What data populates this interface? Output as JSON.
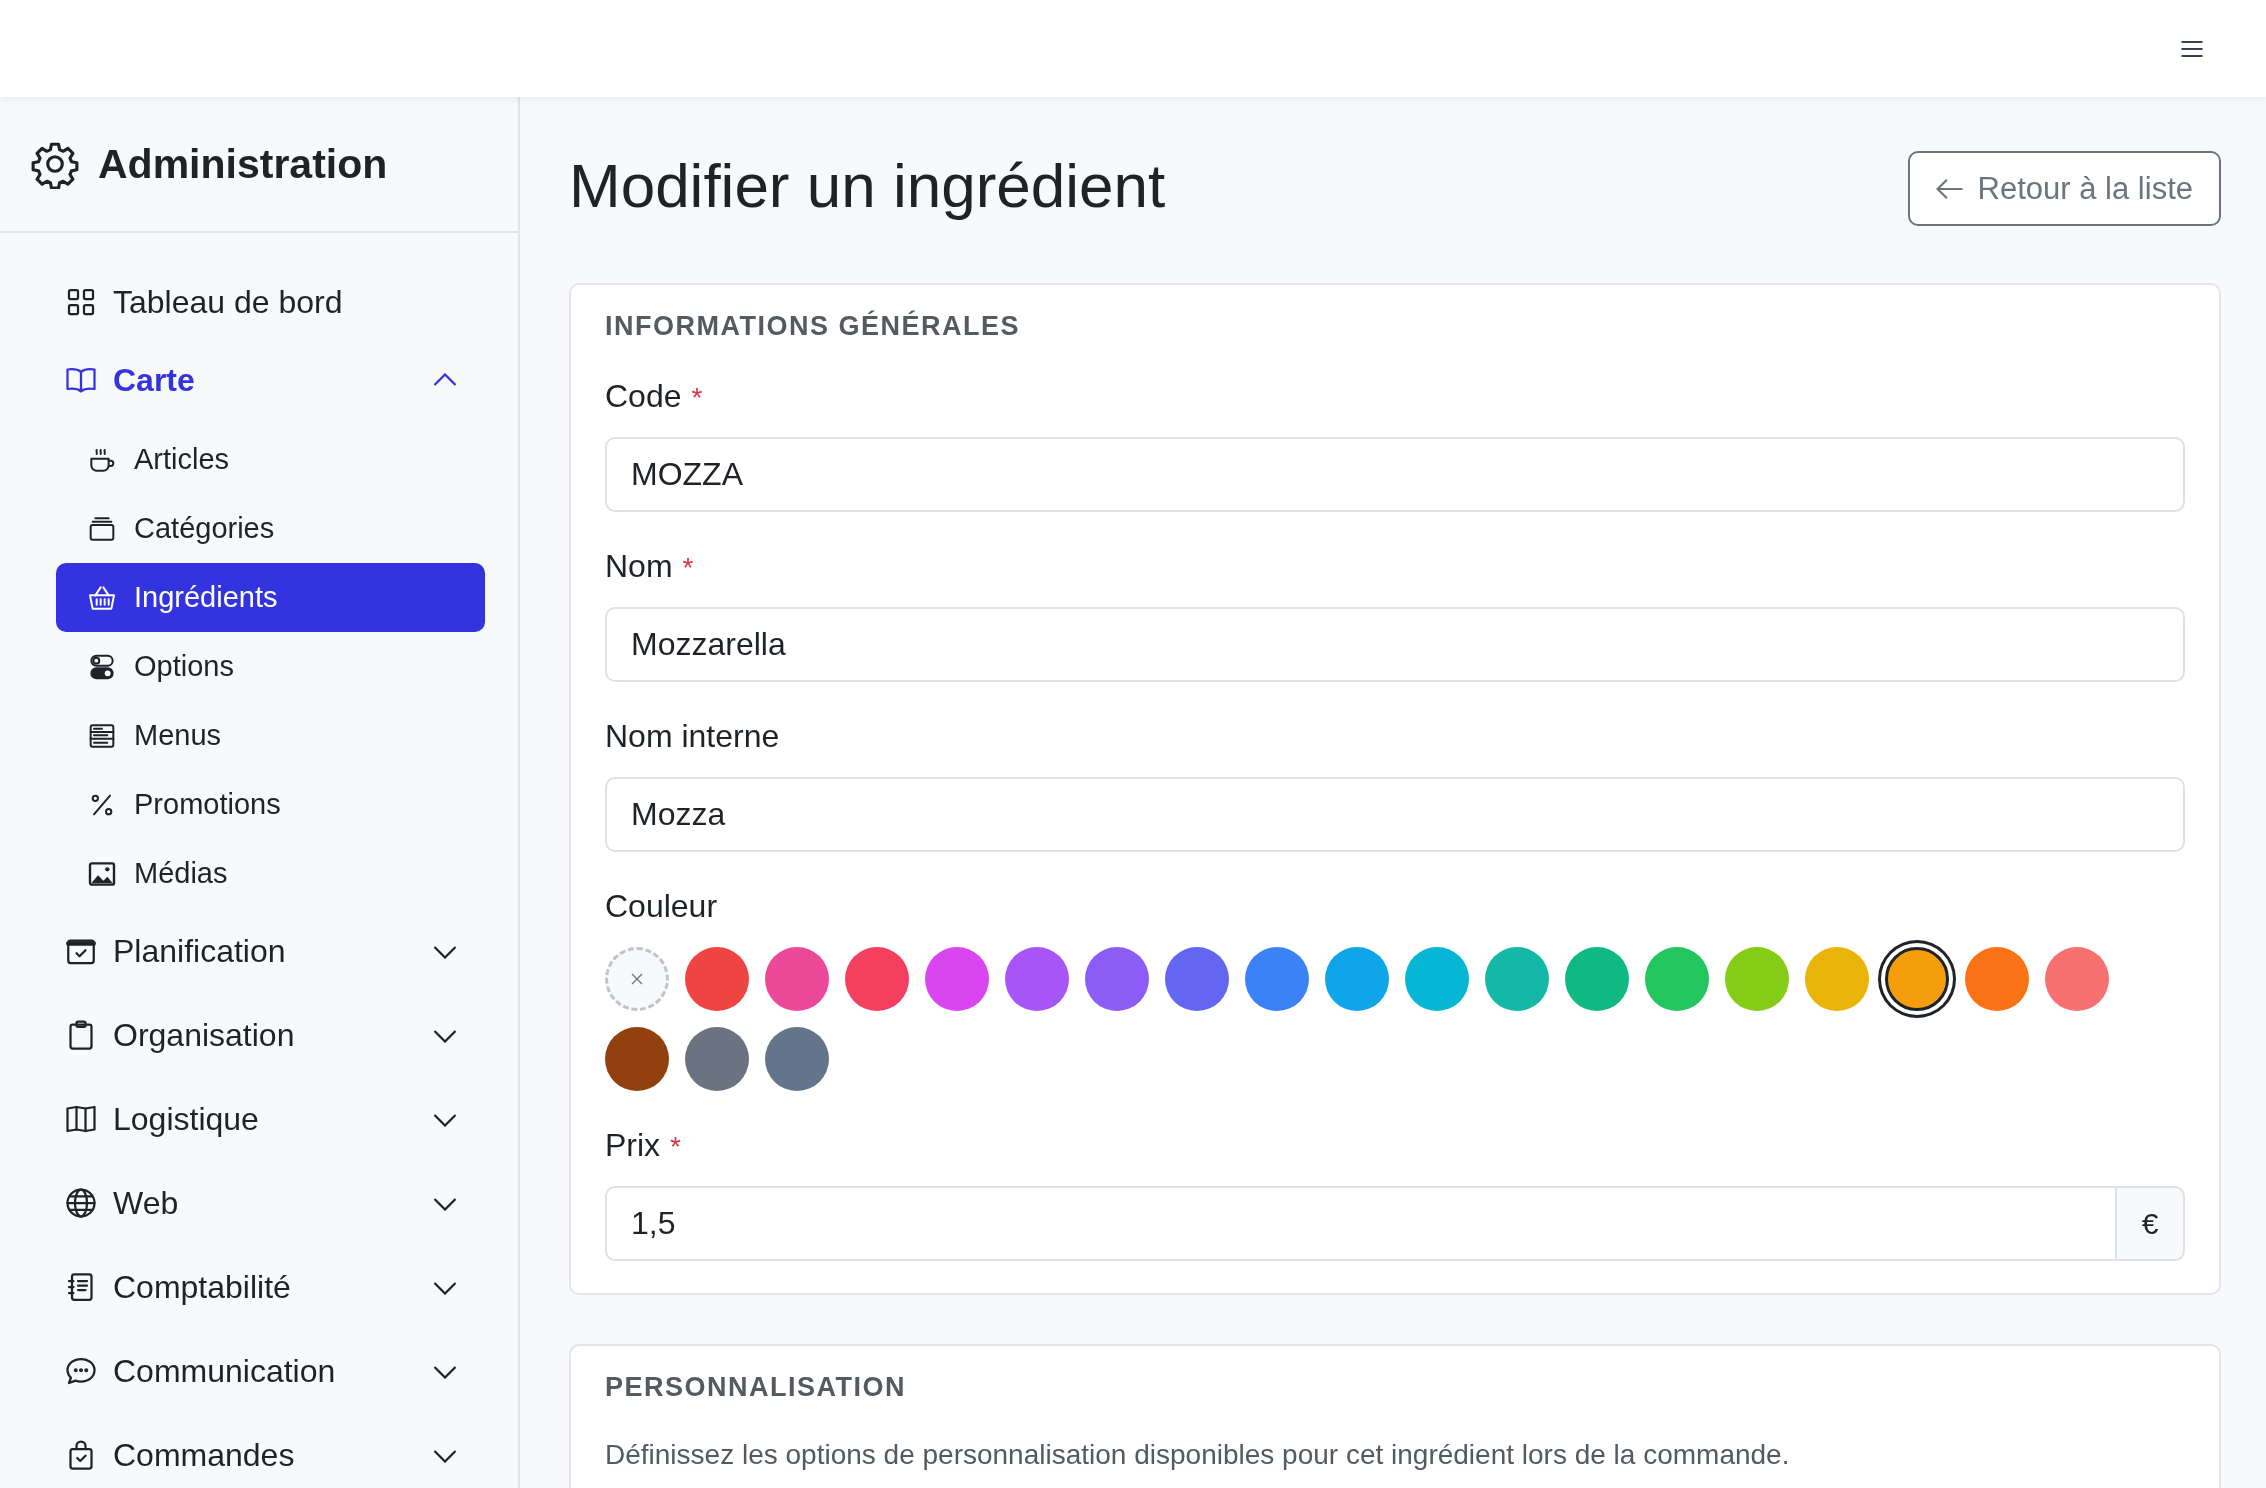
{
  "sidebar": {
    "title": "Administration",
    "items": [
      {
        "kind": "link",
        "label": "Tableau de bord",
        "selected": false
      },
      {
        "kind": "group",
        "label": "Carte",
        "expanded": true,
        "children": [
          {
            "label": "Articles",
            "selected": false
          },
          {
            "label": "Catégories",
            "selected": false
          },
          {
            "label": "Ingrédients",
            "selected": true
          },
          {
            "label": "Options",
            "selected": false
          },
          {
            "label": "Menus",
            "selected": false
          },
          {
            "label": "Promotions",
            "selected": false
          },
          {
            "label": "Médias",
            "selected": false
          }
        ]
      },
      {
        "kind": "group",
        "label": "Planification",
        "expanded": false
      },
      {
        "kind": "group",
        "label": "Organisation",
        "expanded": false
      },
      {
        "kind": "group",
        "label": "Logistique",
        "expanded": false
      },
      {
        "kind": "group",
        "label": "Web",
        "expanded": false
      },
      {
        "kind": "group",
        "label": "Comptabilité",
        "expanded": false
      },
      {
        "kind": "group",
        "label": "Communication",
        "expanded": false
      },
      {
        "kind": "group",
        "label": "Commandes",
        "expanded": false
      }
    ]
  },
  "page": {
    "title": "Modifier un ingrédient",
    "back_button": "Retour à la liste"
  },
  "general": {
    "heading": "INFORMATIONS GÉNÉRALES",
    "fields": [
      {
        "kind": "text",
        "label": "Code",
        "required_mark": "*",
        "value": "MOZZA"
      },
      {
        "kind": "text",
        "label": "Nom",
        "required_mark": "*",
        "value": "Mozzarella"
      },
      {
        "kind": "text",
        "label": "Nom interne",
        "value": "Mozza"
      },
      {
        "kind": "color",
        "label": "Couleur",
        "swatches": [
          {
            "kind": "none",
            "selected": false
          },
          {
            "kind": "color",
            "color": "#ef4444",
            "selected": false
          },
          {
            "kind": "color",
            "color": "#ec4899",
            "selected": false
          },
          {
            "kind": "color",
            "color": "#f43f5e",
            "selected": false
          },
          {
            "kind": "color",
            "color": "#d946ef",
            "selected": false
          },
          {
            "kind": "color",
            "color": "#a855f7",
            "selected": false
          },
          {
            "kind": "color",
            "color": "#8b5cf6",
            "selected": false
          },
          {
            "kind": "color",
            "color": "#6366f1",
            "selected": false
          },
          {
            "kind": "color",
            "color": "#3b82f6",
            "selected": false
          },
          {
            "kind": "color",
            "color": "#0ea5e9",
            "selected": false
          },
          {
            "kind": "color",
            "color": "#06b6d4",
            "selected": false
          },
          {
            "kind": "color",
            "color": "#14b8a6",
            "selected": false
          },
          {
            "kind": "color",
            "color": "#10b981",
            "selected": false
          },
          {
            "kind": "color",
            "color": "#22c55e",
            "selected": false
          },
          {
            "kind": "color",
            "color": "#84cc16",
            "selected": false
          },
          {
            "kind": "color",
            "color": "#eab308",
            "selected": false
          },
          {
            "kind": "color",
            "color": "#f59e0b",
            "selected": true
          },
          {
            "kind": "color",
            "color": "#f97316",
            "selected": false
          },
          {
            "kind": "color",
            "color": "#f87171",
            "selected": false
          },
          {
            "kind": "color",
            "color": "#92400e",
            "selected": false
          },
          {
            "kind": "color",
            "color": "#6b7280",
            "selected": false
          },
          {
            "kind": "color",
            "color": "#64748b",
            "selected": false
          }
        ]
      },
      {
        "kind": "addon",
        "label": "Prix",
        "required_mark": "*",
        "value": "1,5",
        "addon": "€"
      }
    ]
  },
  "customization": {
    "heading": "PERSONNALISATION",
    "text": "Définissez les options de personnalisation disponibles pour cet ingrédient lors de la commande."
  }
}
